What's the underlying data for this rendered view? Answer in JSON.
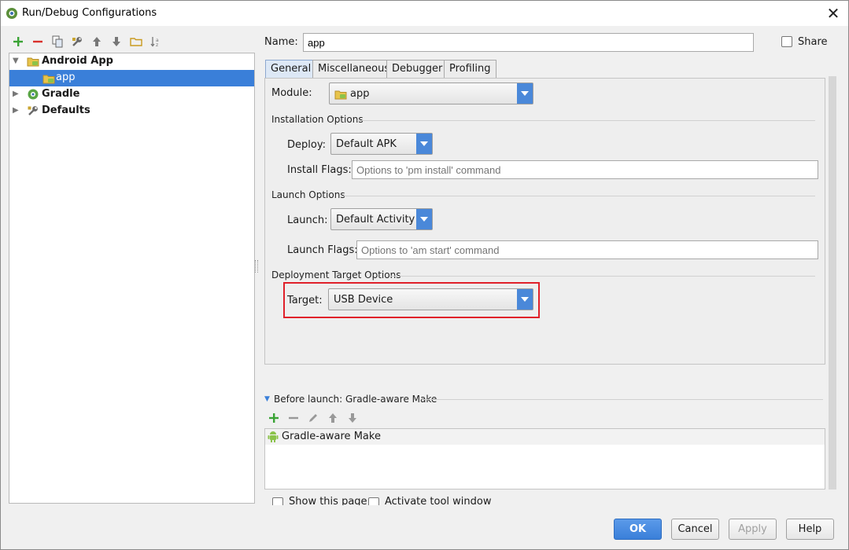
{
  "window": {
    "title": "Run/Debug Configurations",
    "close_glyph": "✕"
  },
  "tree": {
    "items": [
      {
        "label": "Android App",
        "bold": true
      },
      {
        "label": "app",
        "selected": true
      },
      {
        "label": "Gradle",
        "bold": true
      },
      {
        "label": "Defaults",
        "bold": true
      }
    ]
  },
  "name_field": {
    "label": "Name:",
    "value": "app"
  },
  "share": {
    "label": "Share",
    "checked": false
  },
  "tabs": [
    {
      "label": "General",
      "active": true
    },
    {
      "label": "Miscellaneous"
    },
    {
      "label": "Debugger"
    },
    {
      "label": "Profiling"
    }
  ],
  "general": {
    "module_label": "Module:",
    "module_value": "app",
    "installation_section": "Installation Options",
    "deploy_label": "Deploy:",
    "deploy_value": "Default APK",
    "install_flags_label": "Install Flags:",
    "install_flags_placeholder": "Options to 'pm install' command",
    "launch_section": "Launch Options",
    "launch_label": "Launch:",
    "launch_value": "Default Activity",
    "launch_flags_label": "Launch Flags:",
    "launch_flags_placeholder": "Options to 'am start' command",
    "deployment_section": "Deployment Target Options",
    "target_label": "Target:",
    "target_value": "USB Device"
  },
  "before_launch": {
    "header": "Before launch: Gradle-aware Make",
    "items": [
      "Gradle-aware Make"
    ]
  },
  "bottom_options": {
    "show_page": "Show this page",
    "activate_tool_window": "Activate tool window"
  },
  "buttons": {
    "ok": "OK",
    "cancel": "Cancel",
    "apply": "Apply",
    "help": "Help"
  },
  "colors": {
    "accent": "#3a7fd9",
    "add": "#3aa335",
    "remove": "#d9302b",
    "highlight": "#e0202a",
    "android": "#8bc34a"
  }
}
